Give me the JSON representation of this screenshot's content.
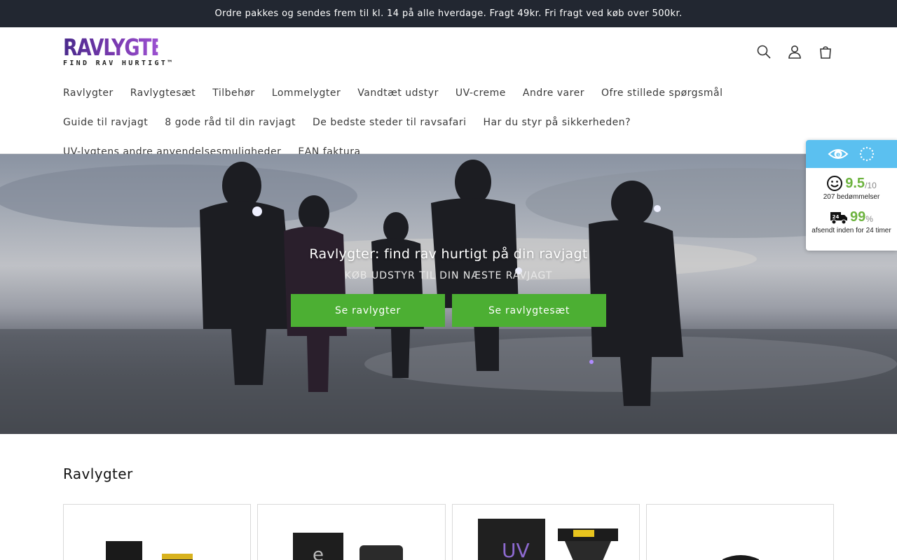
{
  "announcement": {
    "text": "Ordre pakkes og sendes frem til kl. 14 på alle hverdage. Fragt 49kr. Fri fragt ved køb over 500kr."
  },
  "logo": {
    "brand": "RAVLYGTER.DK",
    "tagline": "FIND RAV HURTIGT™"
  },
  "header_icons": [
    "search-icon",
    "account-icon",
    "cart-icon"
  ],
  "nav": {
    "items": [
      "Ravlygter",
      "Ravlygtesæt",
      "Tilbehør",
      "Lommelygter",
      "Vandtæt udstyr",
      "UV-creme",
      "Andre varer",
      "Ofre stillede spørgsmål",
      "Guide til ravjagt",
      "8 gode råd til din ravjagt",
      "De bedste steder til ravsafari",
      "Har du styr på sikkerheden?",
      "UV-lygtens andre anvendelsesmuligheder",
      "EAN faktura"
    ]
  },
  "hero": {
    "title": "Ravlygter: find rav hurtigt på din ravjagt",
    "subtitle": "KØB UDSTYR TIL DIN NÆSTE RAVJAGT",
    "button_1": "Se ravlygter",
    "button_2": "Se ravlygtesæt"
  },
  "trust_widget": {
    "score": "9.5",
    "score_denominator": "/10",
    "reviews": "207 bedømmelser",
    "shipping_percent": "99",
    "percent_sign": "%",
    "shipping_text": "afsendt inden for 24 timer",
    "accent_color": "#5bc0f0",
    "score_color": "#6db33f"
  },
  "section": {
    "title": "Ravlygter"
  },
  "colors": {
    "announcement_bg": "#222731",
    "button_green": "#4caf33",
    "brand_purple": "#7a3ab0"
  }
}
